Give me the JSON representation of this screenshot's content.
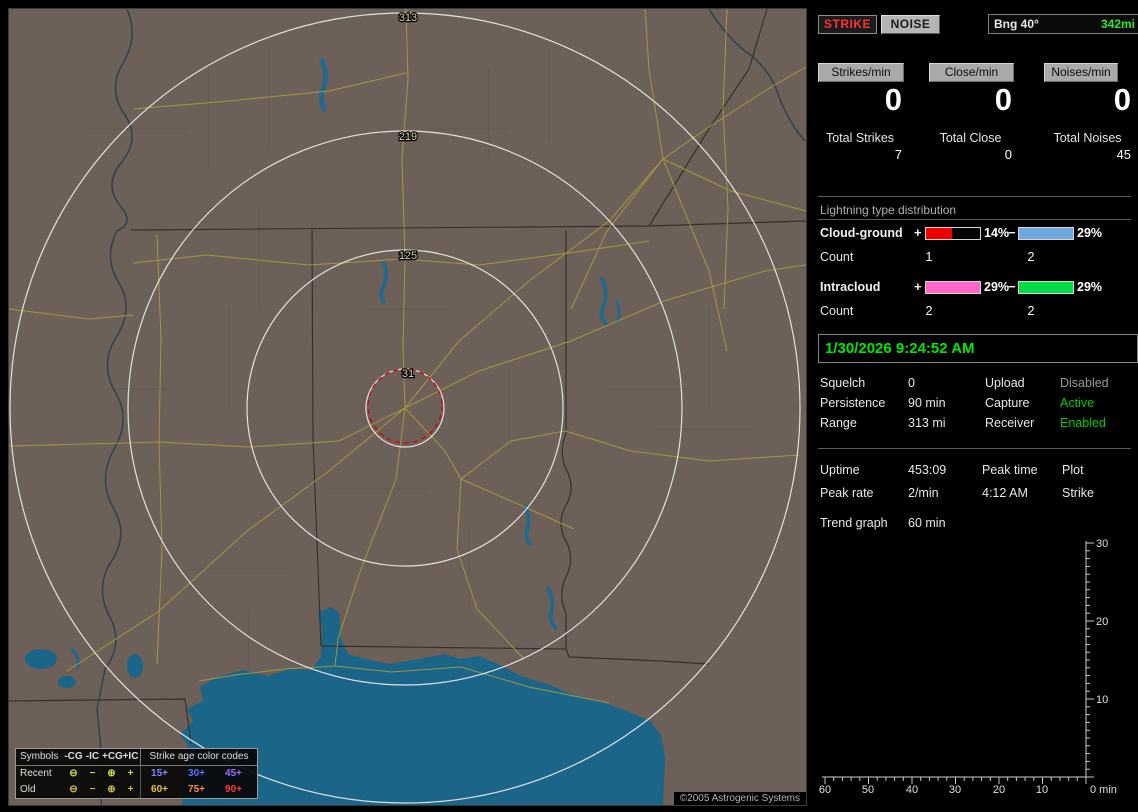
{
  "map": {
    "ring_labels": [
      "313",
      "219",
      "125",
      "31"
    ],
    "copyright": "©2005 Astrogenic Systems",
    "legend": {
      "symbols_header": "Symbols",
      "polarity_headers": [
        "-CG",
        "-IC",
        "+CG",
        "+IC"
      ],
      "age_header": "Strike age color codes",
      "rows": [
        {
          "label": "Recent",
          "symbols": [
            "⊖",
            "−",
            "⊕",
            "+"
          ],
          "ages": [
            "15+",
            "30+",
            "45+"
          ]
        },
        {
          "label": "Old",
          "symbols": [
            "⊖",
            "−",
            "⊕",
            "+"
          ],
          "ages": [
            "60+",
            "75+",
            "90+"
          ]
        }
      ],
      "age_colors_recent": [
        "#7b8bff",
        "#5f6fff",
        "#9b6bff"
      ],
      "age_colors_old": [
        "#e6c24a",
        "#ff8c3a",
        "#ff3a2a"
      ]
    }
  },
  "panel": {
    "strike_button": "STRIKE",
    "noise_button": "NOISE",
    "bearing_label": "Bng 40°",
    "bearing_distance": "342mi",
    "counters": [
      {
        "label": "Strikes/min",
        "value": "0",
        "total_label": "Total Strikes",
        "total": "7"
      },
      {
        "label": "Close/min",
        "value": "0",
        "total_label": "Total Close",
        "total": "0"
      },
      {
        "label": "Noises/min",
        "value": "0",
        "total_label": "Total Noises",
        "total": "45"
      }
    ],
    "distribution": {
      "title": "Lightning type distribution",
      "count_label": "Count",
      "rows": [
        {
          "label": "Cloud-ground",
          "plus": "+",
          "plus_pct": "14%",
          "plus_fill": 48,
          "minus": "−",
          "minus_pct": "29%",
          "minus_fill": 100,
          "count_plus": "1",
          "count_minus": "2"
        },
        {
          "label": "Intracloud",
          "plus": "+",
          "plus_pct": "29%",
          "plus_fill": 100,
          "minus": "−",
          "minus_pct": "29%",
          "minus_fill": 100,
          "count_plus": "2",
          "count_minus": "2"
        }
      ]
    },
    "datetime": "1/30/2026 9:24:52 AM",
    "status_rows": [
      {
        "k1": "Squelch",
        "v1": "0",
        "k2": "Upload",
        "v2": "Disabled"
      },
      {
        "k1": "Persistence",
        "v1": "90 min",
        "k2": "Capture",
        "v2": "Active"
      },
      {
        "k1": "Range",
        "v1": "313 mi",
        "k2": "Receiver",
        "v2": "Enabled"
      }
    ],
    "stats": {
      "uptime_label": "Uptime",
      "uptime": "453:09",
      "peak_time_label": "Peak time",
      "peak_time": "4:12 AM",
      "plot_label": "Plot",
      "plot": "Strike",
      "peak_rate_label": "Peak rate",
      "peak_rate": "2/min",
      "trend_label": "Trend graph",
      "trend_value": "60 min"
    },
    "chart": {
      "y_ticks": [
        "30",
        "20",
        "10"
      ],
      "x_ticks": [
        "60",
        "50",
        "40",
        "30",
        "20",
        "10"
      ],
      "origin_label": "0 min"
    }
  },
  "chart_data": {
    "type": "line",
    "title": "Trend graph (strikes per min)",
    "xlabel": "min",
    "xlim": [
      60,
      0
    ],
    "ylim": [
      0,
      30
    ],
    "x_tick_labels": [
      "60",
      "50",
      "40",
      "30",
      "20",
      "10",
      "0"
    ],
    "y_tick_labels": [
      "0",
      "10",
      "20",
      "30"
    ],
    "series": []
  },
  "colors": {
    "accent_green": "#00e800",
    "strike_red": "#ff3030",
    "cg_plus_bar": "#f20000",
    "cg_minus_bar": "#6fa8dc",
    "ic_plus_bar": "#ff66cc",
    "ic_minus_bar": "#00dd44",
    "land": "#6d6058",
    "water": "#1a6588",
    "roads": "#ab9c3e",
    "range_ring": "#ececec",
    "alert_circle": "#d40000"
  }
}
